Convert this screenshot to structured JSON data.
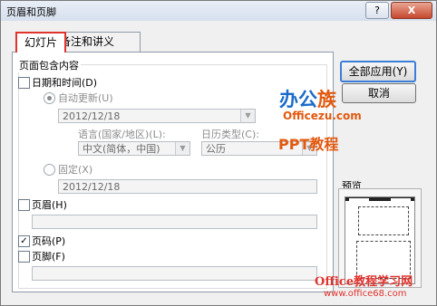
{
  "window": {
    "title": "页眉和页脚",
    "help_label": "?",
    "close_label": "X"
  },
  "tabs": [
    {
      "label": "幻灯片"
    },
    {
      "label": "备注和讲义"
    }
  ],
  "group": {
    "label": "页面包含内容"
  },
  "date_time": {
    "label": "日期和时间(D)",
    "checked": false
  },
  "auto_update": {
    "label": "自动更新(U)",
    "selected": true,
    "date_value": "2012/12/18"
  },
  "language": {
    "label": "语言(国家/地区)(L):",
    "value": "中文(简体，中国)"
  },
  "calendar": {
    "label": "日历类型(C):",
    "value": "公历"
  },
  "fixed": {
    "label": "固定(X)",
    "selected": false,
    "value": "2012/12/18"
  },
  "header": {
    "label": "页眉(H)",
    "checked": false,
    "value": ""
  },
  "page_number": {
    "label": "页码(P)",
    "checked": true,
    "check_mark": "✓"
  },
  "footer": {
    "label": "页脚(F)",
    "checked": false,
    "value": ""
  },
  "buttons": {
    "apply_all": "全部应用(Y)",
    "cancel": "取消"
  },
  "preview": {
    "label": "预览"
  },
  "watermarks": {
    "brand_main": "办公",
    "brand_accent": "族",
    "brand_url": "Officezu.com",
    "ppt_tutorial": "PPT教程",
    "site_name": "Office教程学习网",
    "site_url": "www.office68.com"
  },
  "colors": {
    "tab_highlight": "#e0332e",
    "default_button_border": "#3b7dd8"
  }
}
